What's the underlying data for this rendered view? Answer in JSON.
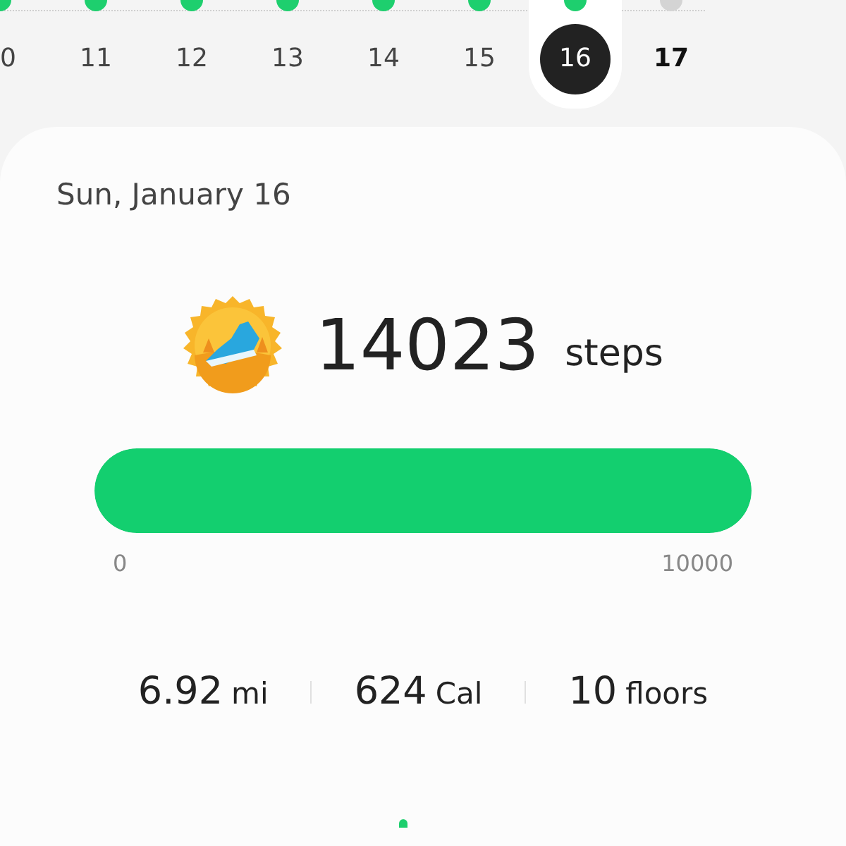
{
  "days": [
    {
      "label": "0",
      "partial": true,
      "selected": false,
      "today": false,
      "goal_met": true
    },
    {
      "label": "11",
      "partial": false,
      "selected": false,
      "today": false,
      "goal_met": true
    },
    {
      "label": "12",
      "partial": false,
      "selected": false,
      "today": false,
      "goal_met": true
    },
    {
      "label": "13",
      "partial": false,
      "selected": false,
      "today": false,
      "goal_met": true
    },
    {
      "label": "14",
      "partial": false,
      "selected": false,
      "today": false,
      "goal_met": true
    },
    {
      "label": "15",
      "partial": false,
      "selected": false,
      "today": false,
      "goal_met": true
    },
    {
      "label": "16",
      "partial": false,
      "selected": true,
      "today": false,
      "goal_met": true
    },
    {
      "label": "17",
      "partial": false,
      "selected": false,
      "today": true,
      "goal_met": false
    }
  ],
  "date": "Sun, January 16",
  "steps": {
    "value": "14023",
    "unit": "steps",
    "level": 1,
    "min_label": "0",
    "max_label": "10000"
  },
  "stats": [
    {
      "value": "6.92",
      "unit": "mi"
    },
    {
      "value": "624",
      "unit": "Cal"
    },
    {
      "value": "10",
      "unit": "floors"
    }
  ]
}
